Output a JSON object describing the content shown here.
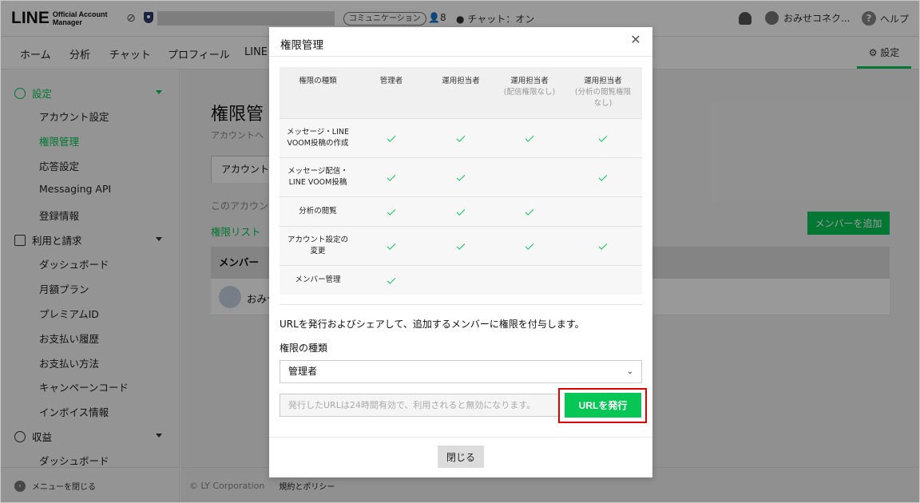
{
  "header": {
    "logo_main": "LINE",
    "logo_sub_line1": "Official Account",
    "logo_sub_line2": "Manager",
    "communication_badge": "コミュニケーション",
    "friends_count": "8",
    "chat_status": "チャット：オン",
    "user_name": "おみせコネク...",
    "help_label": "ヘルプ"
  },
  "nav": {
    "items": [
      "ホーム",
      "分析",
      "チャット",
      "プロフィール",
      "LINE V"
    ],
    "settings_label": "設定"
  },
  "sidebar": {
    "section_settings": "設定",
    "settings_items": [
      "アカウント設定",
      "権限管理",
      "応答設定",
      "Messaging API",
      "登録情報"
    ],
    "section_billing": "利用と請求",
    "billing_items": [
      "ダッシュボード",
      "月額プラン",
      "プレミアムID",
      "お支払い履歴",
      "お支払い方法",
      "キャンペーンコード",
      "インボイス情報"
    ],
    "section_revenue": "収益",
    "revenue_items": [
      "ダッシュボード"
    ],
    "close_menu": "メニューを閉じる"
  },
  "main": {
    "title": "権限管",
    "subtitle": "アカウントへ",
    "tab": "アカウント",
    "desc": "このアカウン",
    "perm_list": "権限リスト",
    "add_member": "メンバーを追加",
    "member_header": "メンバー",
    "member_name": "おみせ",
    "footer_copyright": "© LY Corporation",
    "footer_policy": "規約とポリシー"
  },
  "modal": {
    "title": "権限管理",
    "table": {
      "headers": [
        {
          "label": "権限の種類",
          "note": ""
        },
        {
          "label": "管理者",
          "note": ""
        },
        {
          "label": "運用担当者",
          "note": ""
        },
        {
          "label": "運用担当者",
          "note": "(配信権限なし)"
        },
        {
          "label": "運用担当者",
          "note": "(分析の閲覧権限なし)"
        }
      ],
      "rows": [
        {
          "name": "メッセージ・LINE VOOM投稿の作成",
          "checks": [
            true,
            true,
            true,
            true
          ]
        },
        {
          "name": "メッセージ配信・LINE VOOM投稿",
          "checks": [
            true,
            true,
            false,
            true
          ]
        },
        {
          "name": "分析の閲覧",
          "checks": [
            true,
            true,
            true,
            false
          ]
        },
        {
          "name": "アカウント設定の変更",
          "checks": [
            true,
            true,
            true,
            true
          ]
        },
        {
          "name": "メンバー管理",
          "checks": [
            true,
            false,
            false,
            false
          ]
        }
      ]
    },
    "description": "URLを発行およびシェアして、追加するメンバーに権限を付与します。",
    "type_label": "権限の種類",
    "type_value": "管理者",
    "url_placeholder": "発行したURLは24時間有効で、利用されると無効になります。",
    "issue_button": "URLを発行",
    "close_button": "閉じる"
  },
  "colors": {
    "accent": "#06c755",
    "highlight": "#e00000"
  }
}
